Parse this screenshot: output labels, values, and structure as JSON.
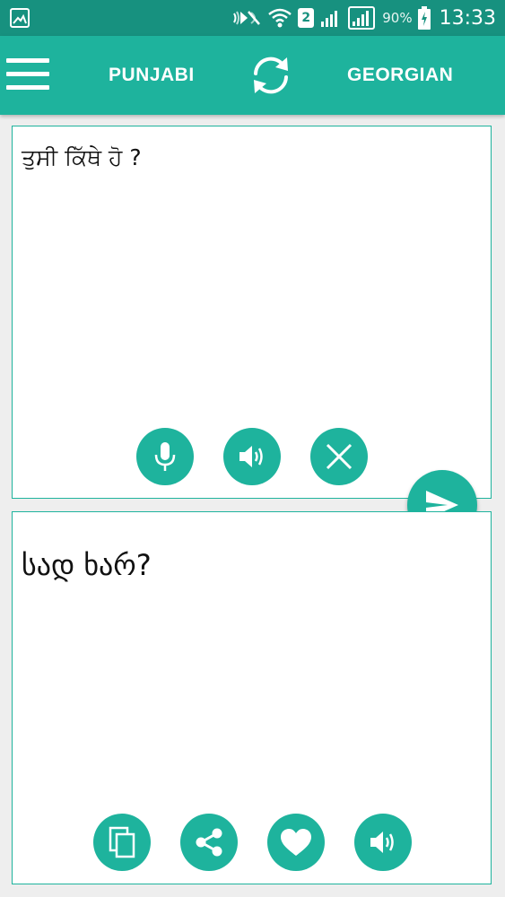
{
  "status_bar": {
    "battery_percent": "90%",
    "time": "13:33",
    "sim_slot": "2",
    "icons": [
      "gallery-icon",
      "mute-icon",
      "wifi-icon",
      "signal-icon",
      "battery-icon"
    ]
  },
  "app_bar": {
    "source_language": "PUNJABI",
    "target_language": "GEORGIAN",
    "icons": [
      "menu-icon",
      "swap-icon"
    ]
  },
  "source_panel": {
    "text": "ਤੁਸੀ ਕਿੱਥੇ ਹੋ ?",
    "actions": [
      "microphone-icon",
      "speaker-icon",
      "clear-icon"
    ]
  },
  "target_panel": {
    "text": "სად ხარ?",
    "actions": [
      "copy-icon",
      "share-icon",
      "favorite-icon",
      "speaker-icon"
    ]
  },
  "translate_button": {
    "icon": "send-icon"
  },
  "colors": {
    "primary": "#1eb39d",
    "status_bar": "#17917f",
    "background": "#eeeeee",
    "panel": "#ffffff",
    "text": "#111111"
  }
}
